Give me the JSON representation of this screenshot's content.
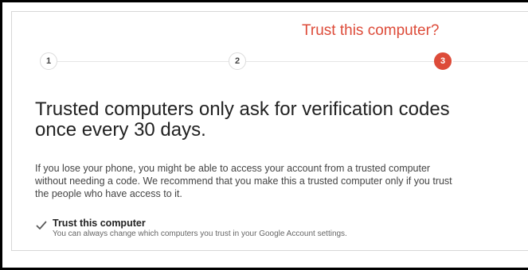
{
  "stepper": {
    "current_title": "Trust this computer?",
    "steps": [
      {
        "label": "1",
        "state": "inactive"
      },
      {
        "label": "2",
        "state": "inactive"
      },
      {
        "label": "3",
        "state": "active"
      }
    ]
  },
  "content": {
    "headline": "Trusted computers only ask for verification codes once every 30 days.",
    "body": "If you lose your phone, you might be able to access your account from a trusted computer without needing a code. We recommend that you make this a trusted computer only if you trust the people who have access to it."
  },
  "trust_option": {
    "checked": true,
    "label": "Trust this computer",
    "sublabel": "You can always change which computers you trust in your Google Account settings."
  },
  "colors": {
    "accent": "#dd4b39",
    "headline": "#222222",
    "body": "#444444",
    "muted": "#666666"
  },
  "icons": {
    "checkbox": "checkmark-icon"
  }
}
